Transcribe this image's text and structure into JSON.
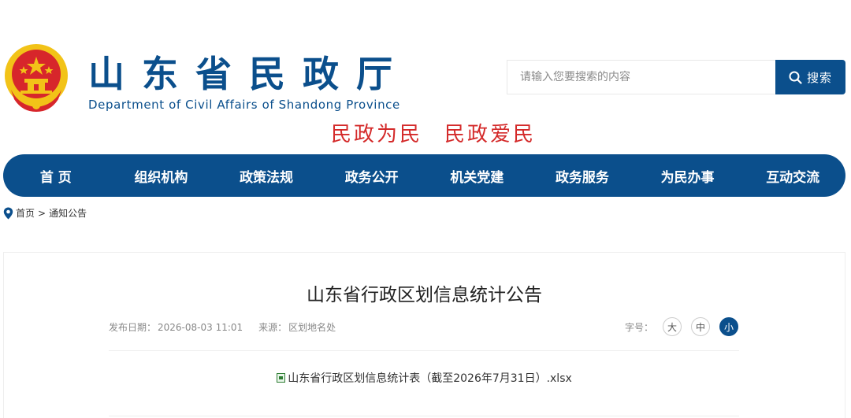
{
  "header": {
    "title": "山东省民政厅",
    "subtitle": "Department of Civil Affairs of Shandong Province",
    "slogan": [
      "民政为民",
      "民政爱民"
    ]
  },
  "search": {
    "placeholder": "请输入您要搜索的内容",
    "button_label": "搜索"
  },
  "nav": {
    "items": [
      "首 页",
      "组织机构",
      "政策法规",
      "政务公开",
      "机关党建",
      "政务服务",
      "为民办事",
      "互动交流"
    ]
  },
  "breadcrumb": {
    "home": "首页",
    "separator": ">",
    "current": "通知公告"
  },
  "article": {
    "title": "山东省行政区划信息统计公告",
    "publish_label": "发布日期：",
    "publish_date": "2026-08-03 11:01",
    "source_label": "来源：",
    "source": "区划地名处",
    "font_size_label": "字号：",
    "font_sizes": [
      "大",
      "中",
      "小"
    ],
    "active_font_size": "小",
    "attachment": "山东省行政区划信息统计表（截至2026年7月31日）.xlsx"
  },
  "colors": {
    "brand": "#0b4f8c",
    "slogan": "#d42a2a",
    "emblem_red": "#d7262b",
    "emblem_gold": "#f2c318"
  }
}
